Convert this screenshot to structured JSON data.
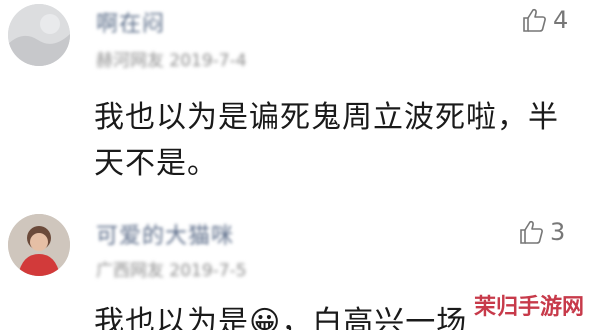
{
  "comments": [
    {
      "username": "啊在闷",
      "meta": "赫河网友 2019-7-4",
      "likes": "4",
      "text": "我也以为是谝死鬼周立波死啦，半天不是。"
    },
    {
      "username": "可爱的大猫咪",
      "meta": "广西网友 2019-7-5",
      "likes": "3",
      "text": "我也以为是😀，白高兴一场"
    }
  ],
  "watermark": "茉归手游网",
  "colors": {
    "username": "#5d6f8a",
    "meta": "#8d8d8d",
    "body": "#1a1a1a",
    "like": "#777777",
    "watermark": "#c73a4a"
  },
  "icons": [
    "avatar",
    "thumbs-up-icon"
  ]
}
